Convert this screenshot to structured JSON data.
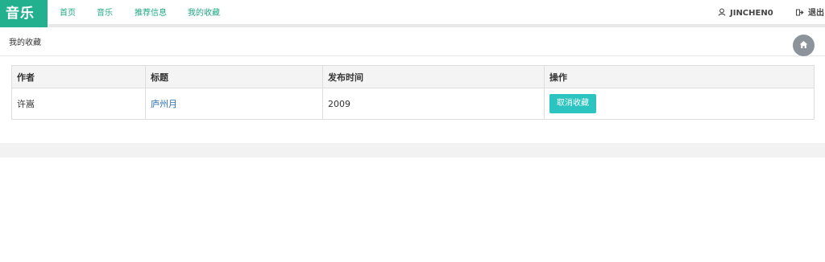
{
  "brand": {
    "title": "音乐",
    "color": "#22b08f"
  },
  "nav": {
    "links": [
      {
        "label": "首页"
      },
      {
        "label": "音乐"
      },
      {
        "label": "推荐信息"
      },
      {
        "label": "我的收藏"
      }
    ],
    "user": {
      "name": "JINCHEN0",
      "icon": "user-icon"
    },
    "logout": {
      "label": "退出",
      "icon": "sign-out-icon"
    }
  },
  "breadcrumb": {
    "label": "我的收藏",
    "home_icon": "home-icon"
  },
  "table": {
    "headers": [
      "作者",
      "标题",
      "发布时间",
      "操作"
    ],
    "rows": [
      {
        "author": "许嵩",
        "title": "庐州月",
        "date": "2009",
        "action": "取消收藏"
      }
    ]
  },
  "colors": {
    "accent": "#22b08f",
    "button": "#2cc4c0",
    "link": "#2a6fb0"
  }
}
